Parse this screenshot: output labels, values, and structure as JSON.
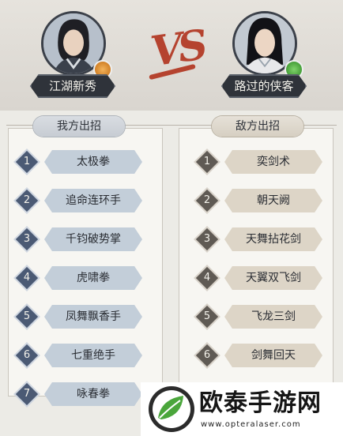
{
  "player": {
    "name": "江湖新秀"
  },
  "opponent": {
    "name": "路过的侠客"
  },
  "vs_label": "VS",
  "left_panel": {
    "title": "我方出招",
    "moves": [
      {
        "num": "1",
        "name": "太极拳"
      },
      {
        "num": "2",
        "name": "追命连环手"
      },
      {
        "num": "3",
        "name": "千钧破势掌"
      },
      {
        "num": "4",
        "name": "虎啸拳"
      },
      {
        "num": "5",
        "name": "凤舞飘香手"
      },
      {
        "num": "6",
        "name": "七重绝手"
      },
      {
        "num": "7",
        "name": "咏春拳"
      }
    ]
  },
  "right_panel": {
    "title": "敌方出招",
    "moves": [
      {
        "num": "1",
        "name": "奕剑术"
      },
      {
        "num": "2",
        "name": "朝天阙"
      },
      {
        "num": "3",
        "name": "天舞拈花剑"
      },
      {
        "num": "4",
        "name": "天翼双飞剑"
      },
      {
        "num": "5",
        "name": "飞龙三剑"
      },
      {
        "num": "6",
        "name": "剑舞回天"
      }
    ]
  },
  "watermark": {
    "text": "欧泰手游网",
    "url": "www.opteralaser.com"
  },
  "colors": {
    "vs": "#b5432f",
    "name_plate": "#2f333a",
    "player_skill": "#c3ced9",
    "enemy_skill": "#ddd5c7"
  },
  "icons": {
    "player_badge": "coin-badge-icon",
    "opponent_badge": "jade-badge-icon"
  }
}
